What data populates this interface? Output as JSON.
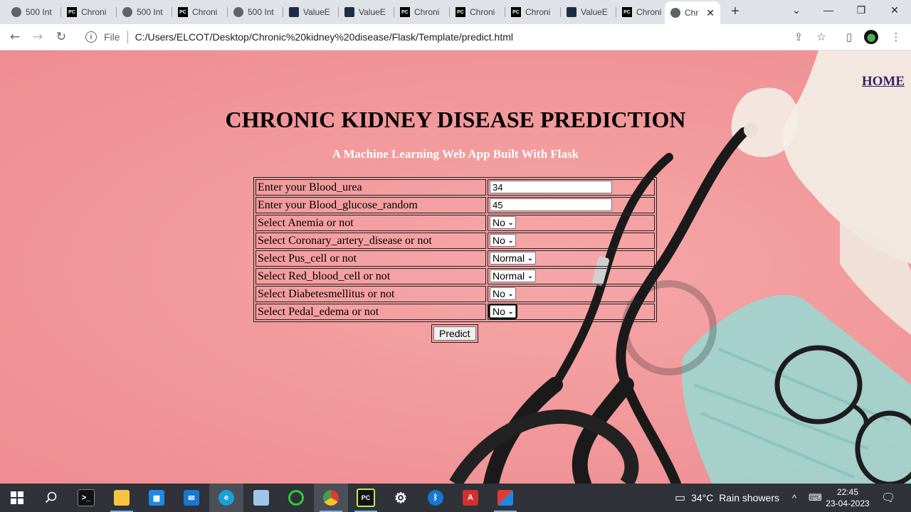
{
  "browser": {
    "tabs": [
      {
        "label": "500 Int",
        "icon": "globe-icon"
      },
      {
        "label": "Chroni",
        "icon": "pycharm-icon"
      },
      {
        "label": "500 Int",
        "icon": "globe-icon"
      },
      {
        "label": "Chroni",
        "icon": "pycharm-icon"
      },
      {
        "label": "500 Int",
        "icon": "globe-icon"
      },
      {
        "label": "ValueE",
        "icon": "valueeducation-icon"
      },
      {
        "label": "ValueE",
        "icon": "valueeducation-icon"
      },
      {
        "label": "Chroni",
        "icon": "pycharm-icon"
      },
      {
        "label": "Chroni",
        "icon": "pycharm-icon"
      },
      {
        "label": "Chroni",
        "icon": "pycharm-icon"
      },
      {
        "label": "ValueE",
        "icon": "valueeducation-icon"
      },
      {
        "label": "Chroni",
        "icon": "pycharm-icon"
      },
      {
        "label": "Chr",
        "icon": "globe-icon",
        "active": true
      }
    ],
    "address": {
      "scheme_label": "File",
      "url": "C:/Users/ELCOT/Desktop/Chronic%20kidney%20disease/Flask/Template/predict.html"
    }
  },
  "page": {
    "home_link": "HOME",
    "title": "CHRONIC KIDNEY DISEASE PREDICTION",
    "subtitle": "A Machine Learning Web App Built With Flask",
    "form": {
      "rows": [
        {
          "label": "Enter your Blood_urea",
          "type": "text",
          "value": "34"
        },
        {
          "label": "Enter your Blood_glucose_random",
          "type": "text",
          "value": "45"
        },
        {
          "label": "Select Anemia or not",
          "type": "select",
          "value": "No"
        },
        {
          "label": "Select Coronary_artery_disease or not",
          "type": "select",
          "value": "No"
        },
        {
          "label": "Select Pus_cell or not",
          "type": "select",
          "value": "Normal"
        },
        {
          "label": "Select Red_blood_cell or not",
          "type": "select",
          "value": "Normal"
        },
        {
          "label": "Select Diabetesmellitus or not",
          "type": "select",
          "value": "No"
        },
        {
          "label": "Select Pedal_edema or not",
          "type": "select",
          "value": "No"
        }
      ],
      "submit_label": "Predict"
    }
  },
  "taskbar": {
    "weather": {
      "temp": "34°C",
      "condition": "Rain showers"
    },
    "time": "22:45",
    "date": "23-04-2023"
  },
  "colors": {
    "page_background": "#f29a9c",
    "home_link": "#3a1f63",
    "taskbar": "#2f3238"
  }
}
